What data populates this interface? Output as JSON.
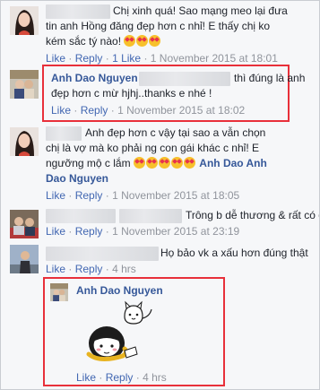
{
  "comments": [
    {
      "text_line1": "Chị xinh quá! Sao mạng meo lại đưa",
      "text_line2": "tin anh Hồng đăng đẹp hơn c nhỉ! E thấy chị ko",
      "text_line3": "kém sắc tý nào!",
      "like": "Like",
      "reply": "Reply",
      "likes_count": "1 Like",
      "timestamp": "1 November 2015 at 18:01"
    },
    {
      "author": "Anh Dao Nguyen",
      "text_line1": "thì đúng là anh",
      "text_line2": "đẹp hơn c mừ hjhj..thanks e nhé !",
      "like": "Like",
      "reply": "Reply",
      "timestamp": "1 November 2015 at 18:02"
    },
    {
      "text_line1": "Anh đẹp hơn c vậy tại sao a vẫn chọn",
      "text_line2": "chị là vợ mà ko phải ng con gái khác c nhỉ! E",
      "text_line3": "ngưỡng mộ c lắm",
      "text_line3_tail": "Anh Dao Anh",
      "text_line4": "Dao Nguyen",
      "like": "Like",
      "reply": "Reply",
      "timestamp": "1 November 2015 at 18:05"
    },
    {
      "text_line1": "Trông b dễ thương & rất có duyên!",
      "like": "Like",
      "reply": "Reply",
      "timestamp": "1 November 2015 at 23:19"
    },
    {
      "text_line1": "Họ bảo vk a xấu hơn đúng thật",
      "like": "Like",
      "reply": "Reply",
      "timestamp": "4 hrs"
    },
    {
      "author": "Anh Dao Nguyen",
      "like": "Like",
      "reply": "Reply",
      "timestamp": "4 hrs"
    }
  ],
  "separator": "·",
  "colors": {
    "link": "#4267b2",
    "name": "#365899",
    "meta": "#90949c",
    "highlight": "#e8303a",
    "emoji": "#f7c12c"
  }
}
